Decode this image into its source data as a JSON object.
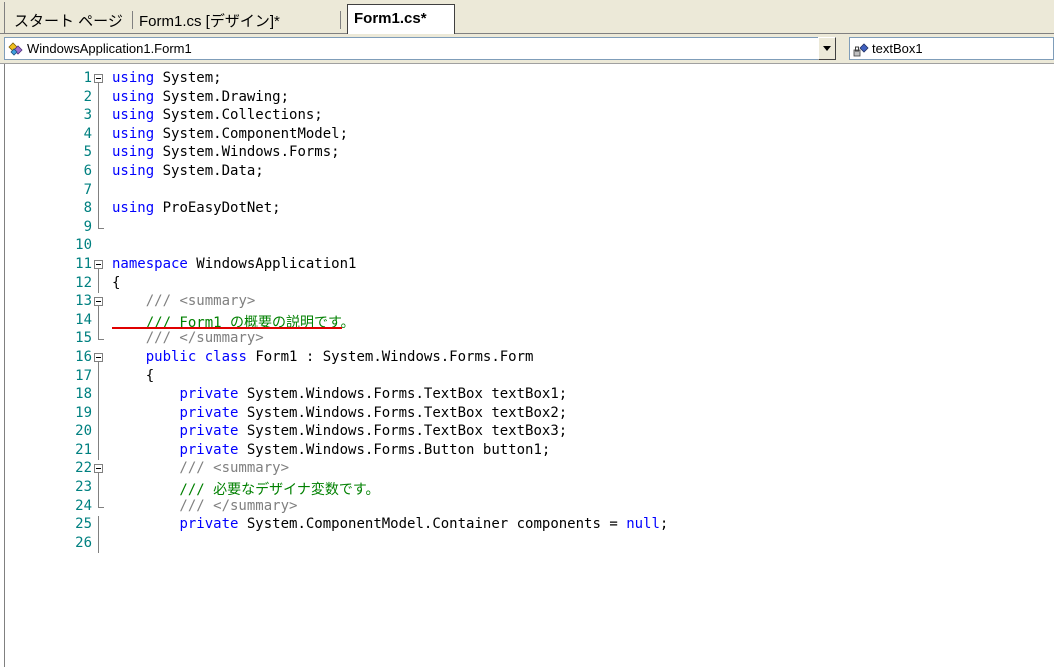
{
  "tabs": [
    {
      "label": "スタート ページ",
      "active": false
    },
    {
      "label": "Form1.cs [デザイン]*",
      "active": false
    },
    {
      "label": "Form1.cs*",
      "active": true
    }
  ],
  "navigation": {
    "class_combo": {
      "value": "WindowsApplication1.Form1",
      "icon": "class-icon"
    },
    "member_combo": {
      "value": "textBox1",
      "icon": "field-icon"
    }
  },
  "colors": {
    "keyword": "#0000ff",
    "comment": "#008000",
    "xmldoc": "#808080",
    "line_number": "#008080",
    "highlight": "#e00000"
  },
  "code_lines": [
    {
      "n": "1",
      "fold": "box",
      "tokens": [
        {
          "t": "using",
          "c": "kw"
        },
        {
          "t": " System;",
          "c": "pl"
        }
      ]
    },
    {
      "n": "2",
      "fold": "line",
      "tokens": [
        {
          "t": "using",
          "c": "kw"
        },
        {
          "t": " System.Drawing;",
          "c": "pl"
        }
      ]
    },
    {
      "n": "3",
      "fold": "line",
      "tokens": [
        {
          "t": "using",
          "c": "kw"
        },
        {
          "t": " System.Collections;",
          "c": "pl"
        }
      ]
    },
    {
      "n": "4",
      "fold": "line",
      "tokens": [
        {
          "t": "using",
          "c": "kw"
        },
        {
          "t": " System.ComponentModel;",
          "c": "pl"
        }
      ]
    },
    {
      "n": "5",
      "fold": "line",
      "tokens": [
        {
          "t": "using",
          "c": "kw"
        },
        {
          "t": " System.Windows.Forms;",
          "c": "pl"
        }
      ]
    },
    {
      "n": "6",
      "fold": "line",
      "tokens": [
        {
          "t": "using",
          "c": "kw"
        },
        {
          "t": " System.Data;",
          "c": "pl"
        }
      ]
    },
    {
      "n": "7",
      "fold": "line",
      "tokens": []
    },
    {
      "n": "8",
      "fold": "line",
      "tokens": [
        {
          "t": "using",
          "c": "kw"
        },
        {
          "t": " ProEasyDotNet;",
          "c": "pl"
        }
      ]
    },
    {
      "n": "9",
      "fold": "end",
      "tokens": []
    },
    {
      "n": "10",
      "fold": "none",
      "tokens": []
    },
    {
      "n": "11",
      "fold": "box",
      "tokens": [
        {
          "t": "namespace",
          "c": "kw"
        },
        {
          "t": " WindowsApplication1",
          "c": "pl"
        }
      ]
    },
    {
      "n": "12",
      "fold": "line",
      "tokens": [
        {
          "t": "{",
          "c": "pl"
        }
      ]
    },
    {
      "n": "13",
      "fold": "box",
      "tokens": [
        {
          "t": "    /// ",
          "c": "xd"
        },
        {
          "t": "<summary>",
          "c": "xd"
        }
      ]
    },
    {
      "n": "14",
      "fold": "line",
      "tokens": [
        {
          "t": "    /// Form1 の概要の説明です。",
          "c": "cm"
        }
      ]
    },
    {
      "n": "15",
      "fold": "end",
      "tokens": [
        {
          "t": "    /// </summary>",
          "c": "xd"
        }
      ]
    },
    {
      "n": "16",
      "fold": "box",
      "tokens": [
        {
          "t": "    ",
          "c": "pl"
        },
        {
          "t": "public",
          "c": "kw"
        },
        {
          "t": " ",
          "c": "pl"
        },
        {
          "t": "class",
          "c": "kw"
        },
        {
          "t": " Form1 : System.Windows.Forms.Form",
          "c": "pl"
        }
      ]
    },
    {
      "n": "17",
      "fold": "line",
      "tokens": [
        {
          "t": "    {",
          "c": "pl"
        }
      ]
    },
    {
      "n": "18",
      "fold": "line",
      "tokens": [
        {
          "t": "        ",
          "c": "pl"
        },
        {
          "t": "private",
          "c": "kw"
        },
        {
          "t": " System.Windows.Forms.TextBox textBox1;",
          "c": "pl"
        }
      ]
    },
    {
      "n": "19",
      "fold": "line",
      "tokens": [
        {
          "t": "        ",
          "c": "pl"
        },
        {
          "t": "private",
          "c": "kw"
        },
        {
          "t": " System.Windows.Forms.TextBox textBox2;",
          "c": "pl"
        }
      ]
    },
    {
      "n": "20",
      "fold": "line",
      "tokens": [
        {
          "t": "        ",
          "c": "pl"
        },
        {
          "t": "private",
          "c": "kw"
        },
        {
          "t": " System.Windows.Forms.TextBox textBox3;",
          "c": "pl"
        }
      ]
    },
    {
      "n": "21",
      "fold": "line",
      "tokens": [
        {
          "t": "        ",
          "c": "pl"
        },
        {
          "t": "private",
          "c": "kw"
        },
        {
          "t": " System.Windows.Forms.Button button1;",
          "c": "pl"
        }
      ]
    },
    {
      "n": "22",
      "fold": "box",
      "tokens": [
        {
          "t": "        /// <summary>",
          "c": "xd"
        }
      ]
    },
    {
      "n": "23",
      "fold": "line",
      "tokens": [
        {
          "t": "        /// 必要なデザイナ変数です。",
          "c": "cm"
        }
      ]
    },
    {
      "n": "24",
      "fold": "end",
      "tokens": [
        {
          "t": "        /// </summary>",
          "c": "xd"
        }
      ]
    },
    {
      "n": "25",
      "fold": "line",
      "tokens": [
        {
          "t": "        ",
          "c": "pl"
        },
        {
          "t": "private",
          "c": "kw"
        },
        {
          "t": " System.ComponentModel.Container components = ",
          "c": "pl"
        },
        {
          "t": "null",
          "c": "kw"
        },
        {
          "t": ";",
          "c": "pl"
        }
      ]
    },
    {
      "n": "26",
      "fold": "line",
      "tokens": []
    }
  ]
}
